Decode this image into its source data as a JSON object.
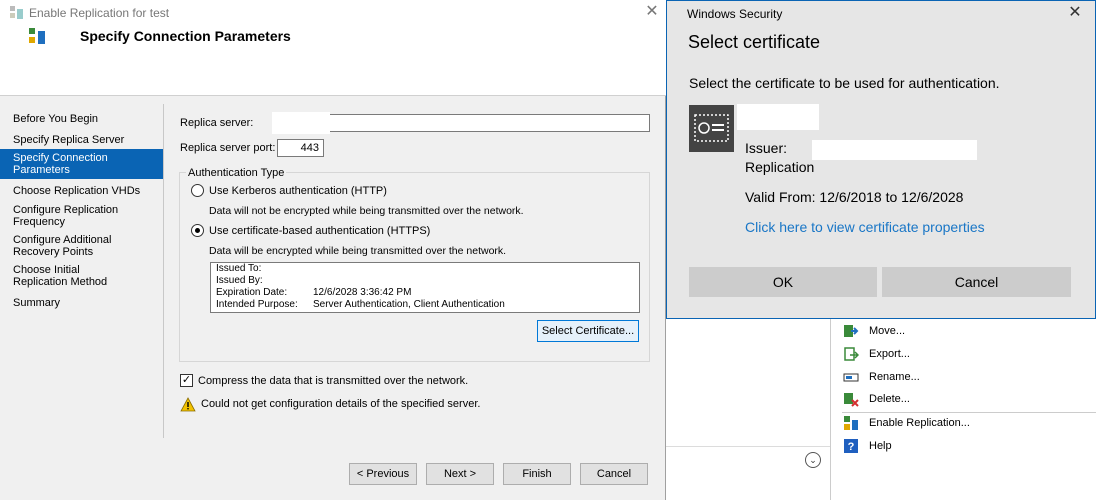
{
  "wizard": {
    "window_title": "Enable Replication for test",
    "header_title": "Specify Connection Parameters",
    "steps": [
      "Before You Begin",
      "Specify Replica Server",
      "Specify Connection Parameters",
      "Choose Replication VHDs",
      "Configure Replication Frequency",
      "Configure Additional Recovery Points",
      "Choose Initial Replication Method",
      "Summary"
    ],
    "replica_server_label": "Replica server:",
    "replica_server_port_label": "Replica server port:",
    "replica_server_port_value": "443",
    "auth_type_label": "Authentication Type",
    "kerberos_label": "Use Kerberos authentication (HTTP)",
    "kerberos_note": "Data will not be encrypted while being transmitted over the network.",
    "cert_auth_label": "Use certificate-based authentication (HTTPS)",
    "cert_auth_note": "Data will be encrypted while being transmitted over the network.",
    "cert_info": {
      "issued_to_label": "Issued To:",
      "issued_by_label": "Issued By:",
      "expiration_label": "Expiration Date:",
      "expiration_value": "12/6/2028 3:36:42 PM",
      "purpose_label": "Intended Purpose:",
      "purpose_value": "Server Authentication, Client Authentication"
    },
    "select_cert_button": "Select Certificate...",
    "compress_label": "Compress the data that is transmitted over the network.",
    "compress_checked": true,
    "warning_text": "Could not get configuration details of the specified server.",
    "buttons": {
      "previous": "< Previous",
      "next": "Next >",
      "finish": "Finish",
      "cancel": "Cancel"
    }
  },
  "security_dialog": {
    "window_title": "Windows Security",
    "heading": "Select certificate",
    "description": "Select the certificate to be used for authentication.",
    "issuer_label": "Issuer:",
    "issuer_value": "Replication",
    "valid_from": "Valid From: 12/6/2018 to 12/6/2028",
    "view_properties_link": "Click here to view certificate properties",
    "ok_button": "OK",
    "cancel_button": "Cancel"
  },
  "actions_pane": {
    "items": [
      {
        "label": "Move...",
        "icon": "move-icon"
      },
      {
        "label": "Export...",
        "icon": "export-icon"
      },
      {
        "label": "Rename...",
        "icon": "rename-icon"
      },
      {
        "label": "Delete...",
        "icon": "delete-icon"
      },
      {
        "label": "Enable Replication...",
        "icon": "enable-replication-icon"
      },
      {
        "label": "Help",
        "icon": "help-icon"
      }
    ]
  },
  "colors": {
    "accent": "#0a64b4",
    "link": "#1976c6",
    "dialog_bg": "#e6e6e6",
    "button_bg": "#cccccc"
  }
}
